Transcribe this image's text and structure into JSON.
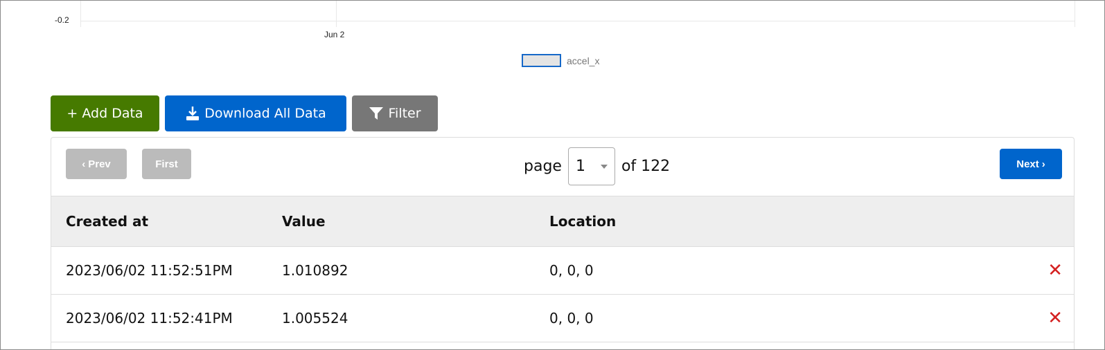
{
  "chart": {
    "y_tick": "-0.2",
    "x_tick": "Jun 2",
    "legend": "accel_x",
    "series_color": "#1668c8"
  },
  "toolbar": {
    "add_label": "+ Add Data",
    "download_label": "Download All Data",
    "filter_label": "Filter",
    "colors": {
      "add": "#467a00",
      "download": "#0065cc",
      "filter": "#777777"
    }
  },
  "pagination": {
    "prev_label": "Prev",
    "first_label": "First",
    "page_label": "page",
    "current_page": "1",
    "of_label": "of 122",
    "next_label": "Next"
  },
  "table": {
    "columns": [
      "Created at",
      "Value",
      "Location"
    ],
    "rows": [
      {
        "created_at": "2023/06/02 11:52:51PM",
        "value": "1.010892",
        "location": "0, 0, 0"
      },
      {
        "created_at": "2023/06/02 11:52:41PM",
        "value": "1.005524",
        "location": "0, 0, 0"
      }
    ],
    "delete_glyph": "✕"
  }
}
